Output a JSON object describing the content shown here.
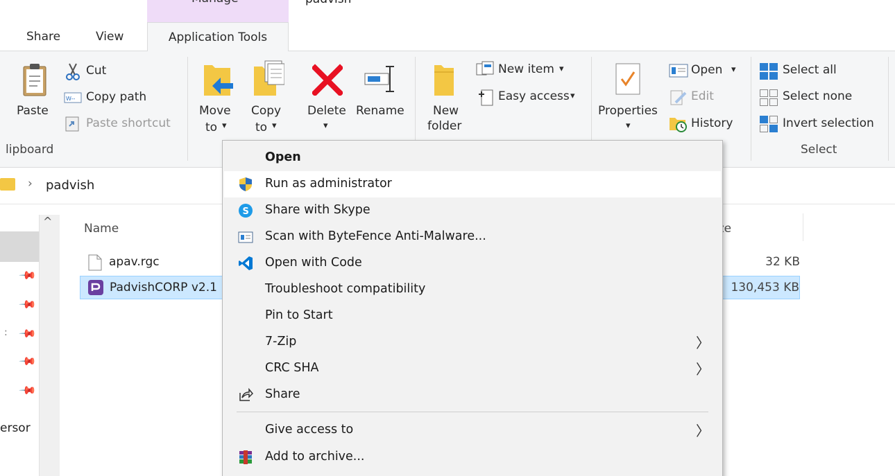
{
  "window": {
    "context_tab_label": "Manage",
    "title": "padvish"
  },
  "tabs": [
    {
      "label": "Share"
    },
    {
      "label": "View"
    },
    {
      "label": "Application Tools"
    }
  ],
  "ribbon": {
    "clipboard": {
      "paste": "Paste",
      "cut": "Cut",
      "copy_path": "Copy path",
      "paste_shortcut": "Paste shortcut",
      "group_label": "lipboard"
    },
    "organize": {
      "move_to_1": "Move",
      "move_to_2": "to",
      "copy_to_1": "Copy",
      "copy_to_2": "to",
      "delete": "Delete",
      "rename": "Rename"
    },
    "new": {
      "new_folder_1": "New",
      "new_folder_2": "folder",
      "new_item": "New item",
      "easy_access": "Easy access"
    },
    "open": {
      "properties": "Properties",
      "open": "Open",
      "edit": "Edit",
      "history": "History"
    },
    "select": {
      "select_all": "Select all",
      "select_none": "Select none",
      "invert_selection": "Invert selection",
      "group_label": "Select"
    },
    "dropdown_glyph": "▾"
  },
  "address": {
    "chevron": "›",
    "path": "padvish"
  },
  "nav": {
    "scroll_up": "^",
    "partial_label": "ersor",
    "colon": ":"
  },
  "file_list": {
    "columns": {
      "name": "Name",
      "size": "ize"
    },
    "files": [
      {
        "name": "apav.rgc",
        "size": "32 KB"
      },
      {
        "name": "PadvishCORP v2.1",
        "size": "130,453 KB"
      }
    ]
  },
  "context_menu": {
    "items": [
      {
        "label": "Open"
      },
      {
        "label": "Run as administrator"
      },
      {
        "label": "Share with Skype"
      },
      {
        "label": "Scan with ByteFence Anti-Malware..."
      },
      {
        "label": "Open with Code"
      },
      {
        "label": "Troubleshoot compatibility"
      },
      {
        "label": "Pin to Start"
      },
      {
        "label": "7-Zip"
      },
      {
        "label": "CRC SHA"
      },
      {
        "label": "Share"
      },
      {
        "label": "Give access to"
      },
      {
        "label": "Add to archive..."
      }
    ],
    "submenu_glyph": "〉"
  },
  "colors": {
    "accent_selection": "#cce8ff",
    "context_tab": "#efdcf8",
    "delete_red": "#e81123",
    "vscode_blue": "#0078d4"
  }
}
